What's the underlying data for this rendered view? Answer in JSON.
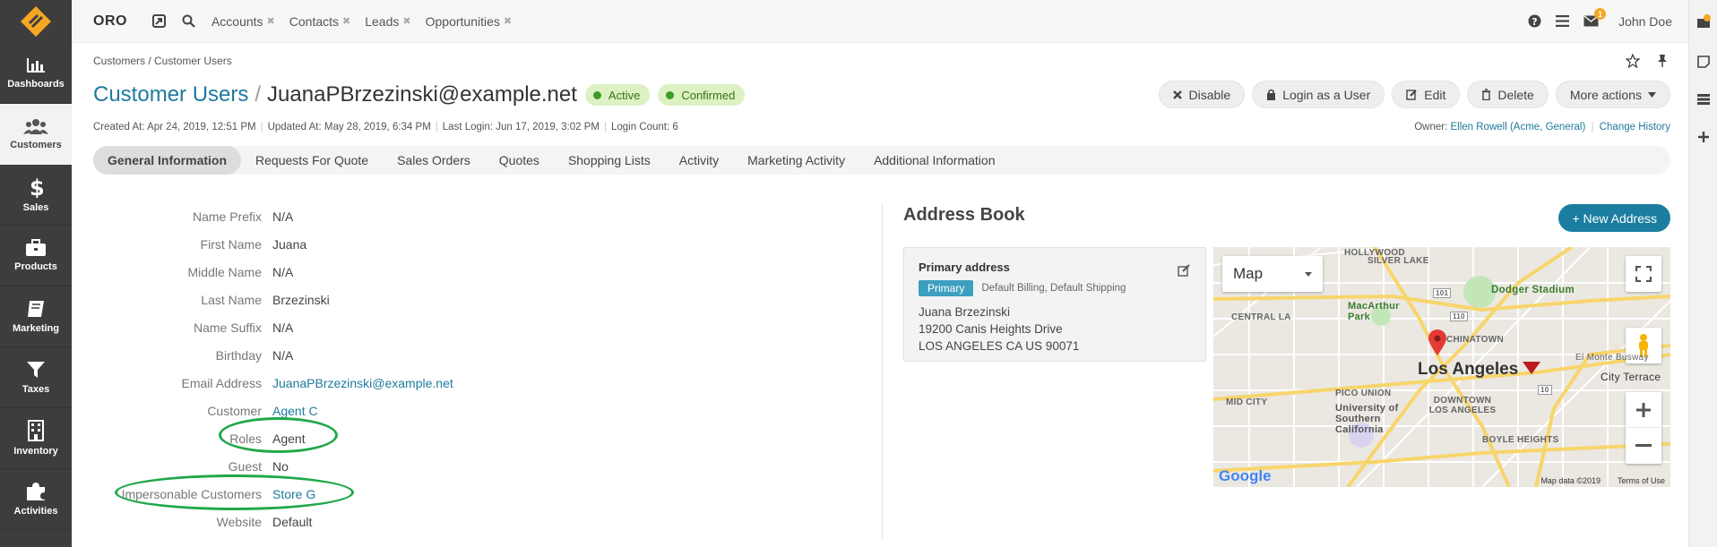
{
  "sidebar": {
    "items": [
      {
        "label": "Dashboards",
        "icon": "dashboards-icon"
      },
      {
        "label": "Customers",
        "icon": "customers-icon",
        "active": true
      },
      {
        "label": "Sales",
        "icon": "dollar-icon"
      },
      {
        "label": "Products",
        "icon": "briefcase-icon"
      },
      {
        "label": "Marketing",
        "icon": "book-icon"
      },
      {
        "label": "Taxes",
        "icon": "filter-icon"
      },
      {
        "label": "Inventory",
        "icon": "building-icon"
      },
      {
        "label": "Activities",
        "icon": "puzzle-icon"
      }
    ]
  },
  "topbar": {
    "brand": "ORO",
    "pinned_links": [
      "Accounts",
      "Contacts",
      "Leads",
      "Opportunities"
    ],
    "notification_count": "1",
    "user": "John Doe"
  },
  "breadcrumb": "Customers / Customer Users",
  "title": {
    "entity": "Customer Users",
    "separator": "/",
    "record": "JuanaPBrzezinski@example.net"
  },
  "badges": [
    "Active",
    "Confirmed"
  ],
  "actions": {
    "disable": "Disable",
    "login_as": "Login as a User",
    "edit": "Edit",
    "delete": "Delete",
    "more": "More actions"
  },
  "meta": {
    "created": "Created At: Apr 24, 2019, 12:51 PM",
    "updated": "Updated At: May 28, 2019, 6:34 PM",
    "last_login": "Last Login: Jun 17, 2019, 3:02 PM",
    "login_count": "Login Count: 6",
    "owner_label": "Owner:",
    "owner_value": "Ellen Rowell (Acme, General)",
    "change_history": "Change History"
  },
  "tabs": [
    "General Information",
    "Requests For Quote",
    "Sales Orders",
    "Quotes",
    "Shopping Lists",
    "Activity",
    "Marketing Activity",
    "Additional Information"
  ],
  "fields": [
    {
      "label": "Name Prefix",
      "value": "N/A",
      "link": false
    },
    {
      "label": "First Name",
      "value": "Juana",
      "link": false
    },
    {
      "label": "Middle Name",
      "value": "N/A",
      "link": false
    },
    {
      "label": "Last Name",
      "value": "Brzezinski",
      "link": false
    },
    {
      "label": "Name Suffix",
      "value": "N/A",
      "link": false
    },
    {
      "label": "Birthday",
      "value": "N/A",
      "link": false
    },
    {
      "label": "Email Address",
      "value": "JuanaPBrzezinski@example.net",
      "link": true
    },
    {
      "label": "Customer",
      "value": "Agent C",
      "link": true
    },
    {
      "label": "Roles",
      "value": "Agent",
      "link": false
    },
    {
      "label": "Guest",
      "value": "No",
      "link": false
    },
    {
      "label": "Impersonable Customers",
      "value": "Store G",
      "link": true
    },
    {
      "label": "Website",
      "value": "Default",
      "link": false
    }
  ],
  "address_book": {
    "title": "Address Book",
    "new_button": "+ New Address",
    "card": {
      "heading": "Primary address",
      "tag": "Primary",
      "types": "Default Billing, Default Shipping",
      "lines": [
        "Juana Brzezinski",
        "19200 Canis Heights Drive",
        "LOS ANGELES CA US 90071"
      ]
    },
    "map": {
      "type_label": "Map",
      "city": "Los Angeles",
      "labels": [
        "HOLLYWOOD",
        "SILVER LAKE",
        "Dodger Stadium",
        "CENTRAL LA",
        "MacArthur Park",
        "CHINATOWN",
        "PICO UNION",
        "MID CITY",
        "University of Southern California",
        "DOWNTOWN LOS ANGELES",
        "BOYLE HEIGHTS",
        "City Terrace",
        "El Monte Busway",
        "101",
        "110",
        "10"
      ],
      "attribution": "Map data ©2019",
      "terms": "Terms of Use",
      "google": "Google"
    }
  }
}
